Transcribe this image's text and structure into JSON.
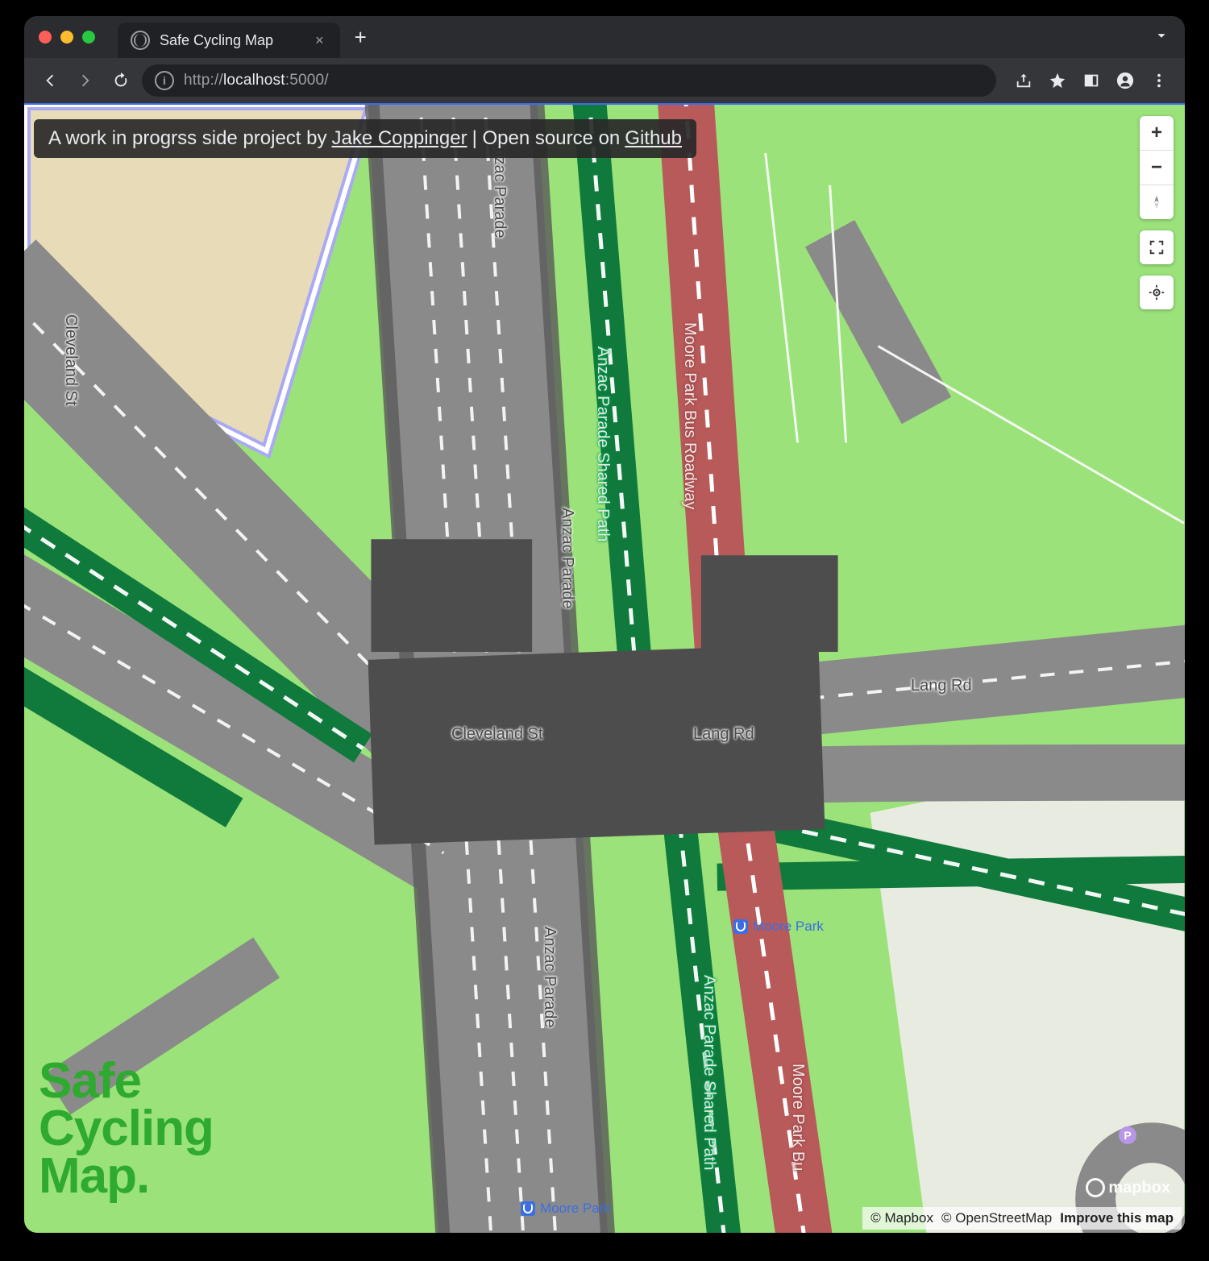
{
  "browser": {
    "tab_title": "Safe Cycling Map",
    "url_scheme": "http://",
    "url_host": "localhost",
    "url_port": ":5000/",
    "close_glyph": "×",
    "newtab_glyph": "+"
  },
  "banner": {
    "prefix": "A work in progrss side project by ",
    "author": "Jake Coppinger",
    "middle": " | Open source on ",
    "repo": "Github"
  },
  "controls": {
    "zoom_in": "+",
    "zoom_out": "−"
  },
  "logo": {
    "line1": "Safe",
    "line2": "Cycling",
    "line3": "Map."
  },
  "mapbox": {
    "text": "mapbox"
  },
  "attribution": {
    "mapbox": "© Mapbox",
    "osm": "© OpenStreetMap",
    "improve": "Improve this map"
  },
  "labels": {
    "cleveland_v": "Cleveland St",
    "anzac_top": "Anzac Parade",
    "anzac_mid": "Anzac Parade",
    "anzac_bot": "Anzac Parade",
    "shared_top": "Anzac Parade Shared Path",
    "shared_bot": "Anzac Parade Shared Path",
    "busway_top": "Moore Park Bus Roadway",
    "busway_bot": "Moore Park Bu",
    "cleveland_h": "Cleveland St",
    "lang_h": "Lang Rd",
    "lang_far": "Lang Rd"
  },
  "transit": {
    "moore_park_1": "Moore Park",
    "moore_park_2": "Moore Park"
  },
  "parking": {
    "p": "P"
  }
}
